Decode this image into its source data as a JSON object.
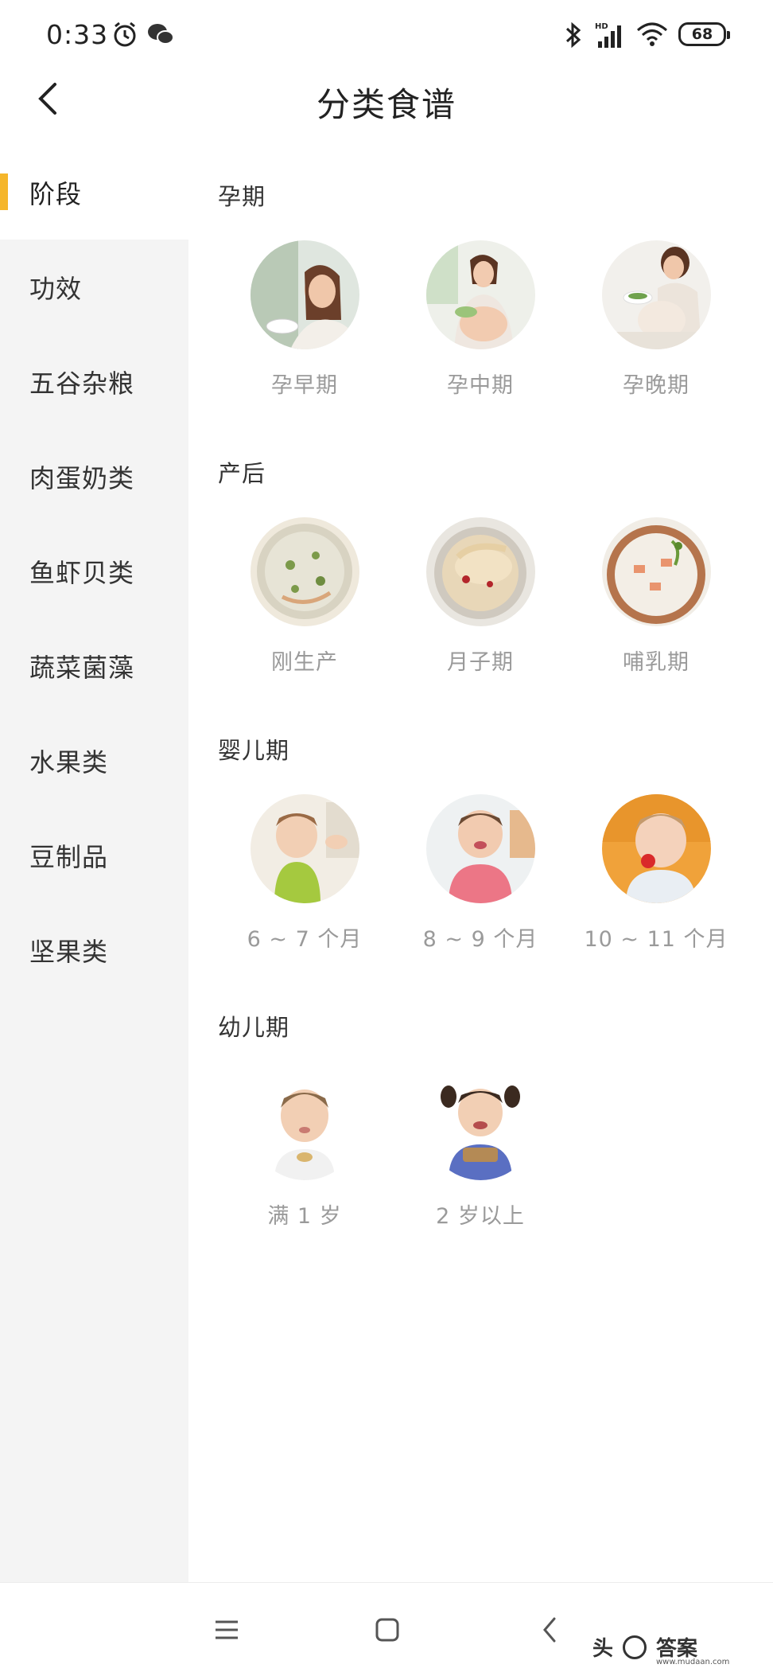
{
  "status": {
    "time": "0:33",
    "battery": "68",
    "icons": [
      "alarm-icon",
      "wechat-icon",
      "bluetooth-icon",
      "hd-signal-icon",
      "wifi-icon"
    ]
  },
  "header": {
    "title": "分类食谱",
    "back_icon": "chevron-left-icon"
  },
  "sidebar": {
    "items": [
      {
        "label": "阶段",
        "active": true
      },
      {
        "label": "功效"
      },
      {
        "label": "五谷杂粮"
      },
      {
        "label": "肉蛋奶类"
      },
      {
        "label": "鱼虾贝类"
      },
      {
        "label": "蔬菜菌藻"
      },
      {
        "label": "水果类"
      },
      {
        "label": "豆制品"
      },
      {
        "label": "坚果类"
      }
    ],
    "accent_color": "#f5b62b"
  },
  "sections": [
    {
      "title": "孕期",
      "items": [
        {
          "label": "孕早期"
        },
        {
          "label": "孕中期"
        },
        {
          "label": "孕晚期"
        }
      ]
    },
    {
      "title": "产后",
      "items": [
        {
          "label": "刚生产"
        },
        {
          "label": "月子期"
        },
        {
          "label": "哺乳期"
        }
      ]
    },
    {
      "title": "婴儿期",
      "items": [
        {
          "label": "6 ~ 7 个月"
        },
        {
          "label": "8 ~ 9 个月"
        },
        {
          "label": "10 ~ 11 个月"
        }
      ]
    },
    {
      "title": "幼儿期",
      "items": [
        {
          "label": "满 1 岁"
        },
        {
          "label": "2 岁以上"
        }
      ]
    }
  ],
  "navbar": {
    "icons": [
      "menu-icon",
      "home-square-icon",
      "back-chevron-icon"
    ],
    "watermark": "答案",
    "watermark_prefix": "头",
    "watermark_url": "www.mudaan.com"
  }
}
